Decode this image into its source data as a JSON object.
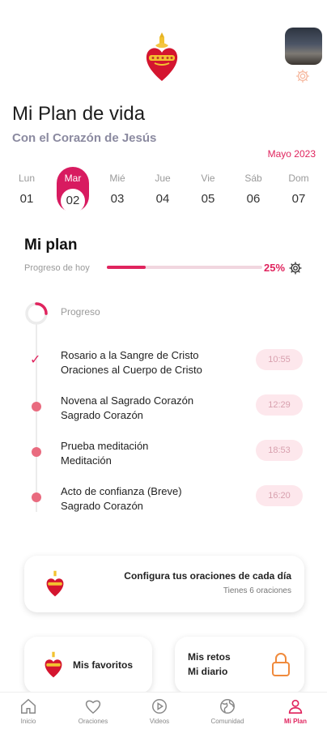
{
  "header": {
    "title": "Mi Plan de vida",
    "subtitle": "Con el Corazón de Jesús",
    "month": "Mayo 2023"
  },
  "days": [
    {
      "name": "Lun",
      "num": "01",
      "active": false
    },
    {
      "name": "Mar",
      "num": "02",
      "active": true
    },
    {
      "name": "Mié",
      "num": "03",
      "active": false
    },
    {
      "name": "Jue",
      "num": "04",
      "active": false
    },
    {
      "name": "Vie",
      "num": "05",
      "active": false
    },
    {
      "name": "Sáb",
      "num": "06",
      "active": false
    },
    {
      "name": "Dom",
      "num": "07",
      "active": false
    }
  ],
  "plan": {
    "title": "Mi plan",
    "progress_label": "Progreso de hoy",
    "progress_percent": 25,
    "progress_text": "25%",
    "ring_label": "Progreso"
  },
  "items": [
    {
      "title": "Rosario a la Sangre de Cristo",
      "category": "Oraciones al Cuerpo de Cristo",
      "time": "10:55",
      "done": true
    },
    {
      "title": "Novena al Sagrado Corazón",
      "category": "Sagrado Corazón",
      "time": "12:29",
      "done": false
    },
    {
      "title": "Prueba meditación",
      "category": "Meditación",
      "time": "18:53",
      "done": false
    },
    {
      "title": "Acto de confianza (Breve)",
      "category": "Sagrado Corazón",
      "time": "16:20",
      "done": false
    }
  ],
  "config_card": {
    "title": "Configura tus oraciones de cada día",
    "subtitle": "Tienes 6 oraciones"
  },
  "favorites_card": {
    "label": "Mis favoritos"
  },
  "retos_card": {
    "line1": "Mis retos",
    "line2": "Mi diario"
  },
  "nav": [
    {
      "label": "Inicio",
      "icon": "home-icon",
      "active": false
    },
    {
      "label": "Oraciones",
      "icon": "heart-icon",
      "active": false
    },
    {
      "label": "Videos",
      "icon": "play-icon",
      "active": false
    },
    {
      "label": "Comunidad",
      "icon": "globe-icon",
      "active": false
    },
    {
      "label": "Mi Plan",
      "icon": "person-icon",
      "active": true
    }
  ],
  "colors": {
    "accent": "#e0245e",
    "timeline_dot": "#e96b7f",
    "time_pill": "#fde7ec",
    "lock": "#f08a3c"
  }
}
